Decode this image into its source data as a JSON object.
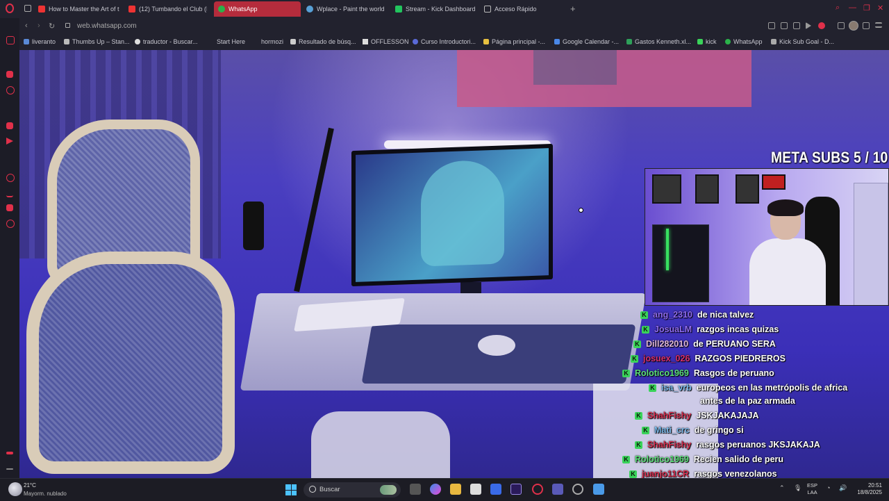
{
  "tabs": [
    {
      "label": "How to Master the Art of t",
      "icon": "youtube-icon",
      "active": false
    },
    {
      "label": "(12) Tumbando el Club (F",
      "icon": "youtube-icon",
      "active": false
    },
    {
      "label": "WhatsApp",
      "icon": "whatsapp-icon",
      "active": true
    },
    {
      "label": "Wplace - Paint the world",
      "icon": "wplace-icon",
      "active": false
    },
    {
      "label": "Stream - Kick Dashboard",
      "icon": "kick-icon",
      "active": false
    },
    {
      "label": "Acceso Rápido",
      "icon": "grid-icon",
      "active": false
    }
  ],
  "new_tab_glyph": "+",
  "address": {
    "url": "web.whatsapp.com"
  },
  "bookmarks": [
    "liveranto",
    "Thumbs Up – Stan...",
    "traductor - Buscar...",
    "Start Here",
    "hormozi",
    "Resultado de búsq...",
    "OFFLESSON",
    "Curso Introductori...",
    "Página principal -...",
    "Google Calendar -...",
    "Gastos Kenneth.xl...",
    "kick",
    "WhatsApp",
    "Kick Sub Goal - D..."
  ],
  "stream": {
    "sub_goal": "META SUBS  5 / 10",
    "chat": [
      {
        "user": "ang_2310",
        "message": "de nica talvez",
        "user_color": "#8f6bf0"
      },
      {
        "user": "JosuaLM",
        "message": "razgos incas quizas",
        "user_color": "#8f6bf0"
      },
      {
        "user": "Dill282010",
        "message": "de PERUANO SERA",
        "user_color": "#e0b8d8"
      },
      {
        "user": "josuex_026",
        "message": "RAZGOS PIEDREROS",
        "user_color": "#d8306a"
      },
      {
        "user": "Rolotico1969",
        "message": "Rasgos de peruano",
        "user_color": "#5ce07a"
      },
      {
        "user": "isa_vrb",
        "message": "europeos en las metrópolis de africa",
        "message2": "antes de la paz armada",
        "user_color": "#7ab8e8"
      },
      {
        "user": "ShahFishy",
        "message": "JSKJAKAJAJA",
        "user_color": "#d83050"
      },
      {
        "user": "Mati_crc",
        "message": "de gringo si",
        "user_color": "#7ab8e8"
      },
      {
        "user": "ShahFishy",
        "message": "rasgos peruanos JKSJAKAJA",
        "user_color": "#d83050"
      },
      {
        "user": "Rolotico1969",
        "message": "Recien salido de peru",
        "user_color": "#5ce07a"
      },
      {
        "user": "juanjo11CR",
        "message": "rasgos venezolanos",
        "user_color": "#d83050"
      }
    ],
    "badge_glyph": "K"
  },
  "taskbar": {
    "weather_temp": "21°C",
    "weather_desc": "Mayorm. nublado",
    "search_label": "Buscar",
    "lang_top": "ESP",
    "lang_bottom": "LAA",
    "time": "20:51",
    "date": "18/8/2025"
  },
  "colors": {
    "accent": "#b52c3c",
    "kick_green": "#3ad35a",
    "opera_red": "#e0304a"
  }
}
